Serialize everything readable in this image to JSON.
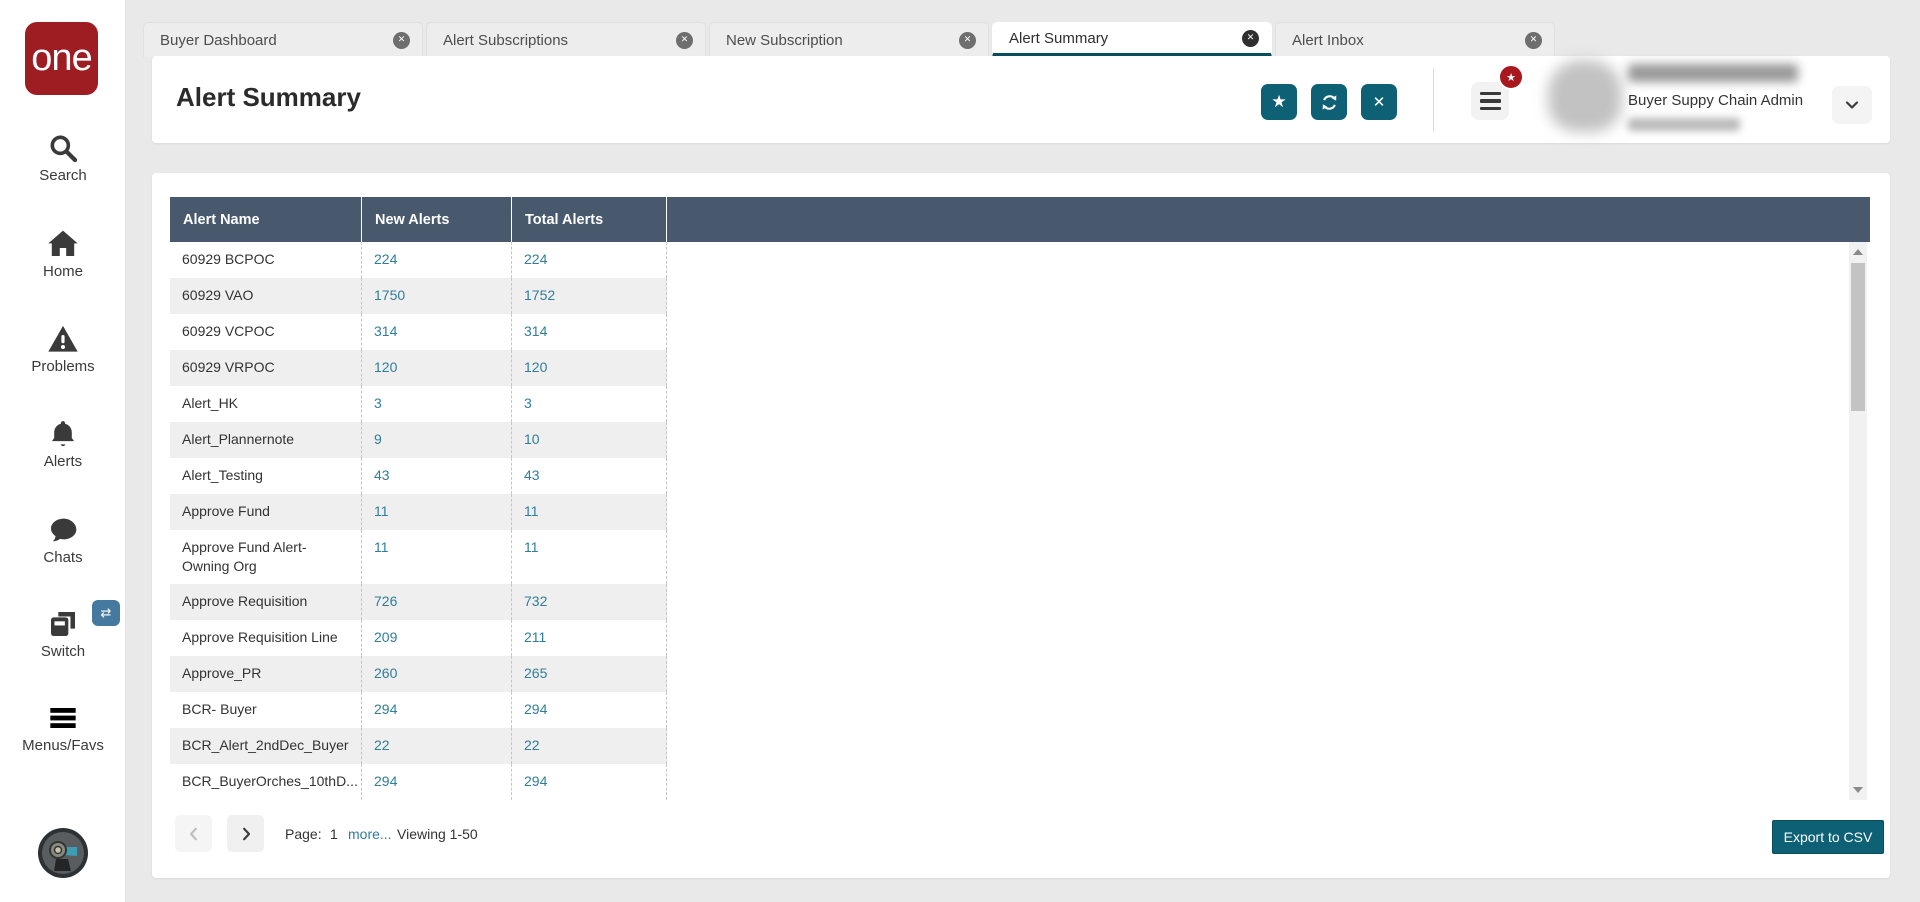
{
  "sidebar": {
    "logo_text": "one",
    "items": [
      {
        "label": "Search",
        "icon": "search-icon"
      },
      {
        "label": "Home",
        "icon": "home-icon"
      },
      {
        "label": "Problems",
        "icon": "warning-triangle-icon"
      },
      {
        "label": "Alerts",
        "icon": "bell-icon"
      },
      {
        "label": "Chats",
        "icon": "chat-bubble-icon"
      },
      {
        "label": "Switch",
        "icon": "switch-panels-icon",
        "badge_icon": "swap-arrows-icon"
      },
      {
        "label": "Menus/Favs",
        "icon": "menu-bars-icon"
      }
    ]
  },
  "tabs": [
    {
      "label": "Buyer Dashboard",
      "active": false
    },
    {
      "label": "Alert Subscriptions",
      "active": false
    },
    {
      "label": "New Subscription",
      "active": false
    },
    {
      "label": "Alert Summary",
      "active": true
    },
    {
      "label": "Alert Inbox",
      "active": false
    }
  ],
  "header": {
    "title": "Alert Summary",
    "actions": [
      {
        "icon": "star-icon"
      },
      {
        "icon": "refresh-icon"
      },
      {
        "icon": "close-icon"
      }
    ],
    "menu_badge_icon": "star-icon",
    "user_role": "Buyer Suppy Chain Admin"
  },
  "table": {
    "columns": [
      "Alert Name",
      "New Alerts",
      "Total Alerts"
    ],
    "rows": [
      [
        "60929 BCPOC",
        "224",
        "224"
      ],
      [
        "60929 VAO",
        "1750",
        "1752"
      ],
      [
        "60929 VCPOC",
        "314",
        "314"
      ],
      [
        "60929 VRPOC",
        "120",
        "120"
      ],
      [
        "Alert_HK",
        "3",
        "3"
      ],
      [
        "Alert_Plannernote",
        "9",
        "10"
      ],
      [
        "Alert_Testing",
        "43",
        "43"
      ],
      [
        "Approve Fund",
        "11",
        "11"
      ],
      [
        "Approve Fund Alert-Owning Org",
        "11",
        "11"
      ],
      [
        "Approve Requisition",
        "726",
        "732"
      ],
      [
        "Approve Requisition Line",
        "209",
        "211"
      ],
      [
        "Approve_PR",
        "260",
        "265"
      ],
      [
        "BCR- Buyer",
        "294",
        "294"
      ],
      [
        "BCR_Alert_2ndDec_Buyer",
        "22",
        "22"
      ],
      [
        "BCR_BuyerOrches_10thD...",
        "294",
        "294"
      ]
    ]
  },
  "pagination": {
    "page_label": "Page:",
    "page_value": "1",
    "more_label": "more...",
    "viewing_label": "Viewing 1-50"
  },
  "footer": {
    "export_label": "Export to CSV"
  },
  "colors": {
    "accent_teal": "#0e6175",
    "active_tab_underline": "#084f5d",
    "table_header": "#48596d",
    "link_teal": "#2f7e9a",
    "logo_red": "#9d1d22",
    "badge_red": "#a8191f",
    "switch_badge_blue": "#45799f",
    "row_alt_gray": "#efefef",
    "page_background": "#e9e9e9"
  }
}
